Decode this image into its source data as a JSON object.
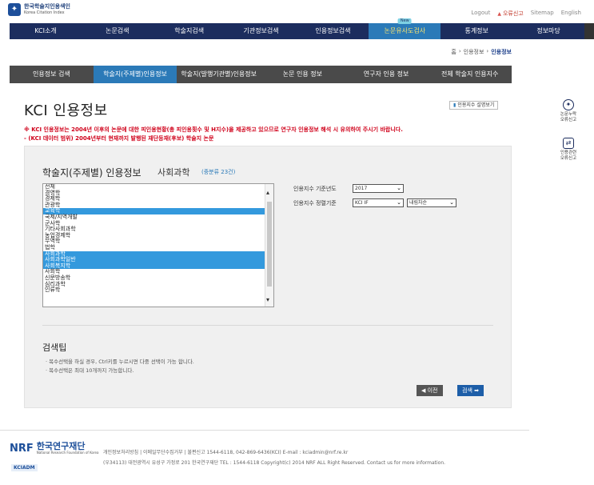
{
  "header": {
    "logo_ko": "한국학술지인용색인",
    "logo_en": "Korea Citation Index",
    "util_links": [
      "Logout",
      "오류신고",
      "Sitemap",
      "English"
    ]
  },
  "main_nav": {
    "items": [
      {
        "label": "KCI소개"
      },
      {
        "label": "논문검색"
      },
      {
        "label": "학술지검색"
      },
      {
        "label": "기관정보검색"
      },
      {
        "label": "인용정보검색"
      },
      {
        "label": "논문유사도검사",
        "badge": "New"
      },
      {
        "label": "통계정보"
      },
      {
        "label": "정보마당"
      }
    ]
  },
  "breadcrumb": {
    "home": "홈",
    "sep": "›",
    "parent": "인용정보",
    "current": "인용정보"
  },
  "sub_nav": {
    "items": [
      "인용정보 검색",
      "학술지(주제별)인용정보",
      "학술지(발행기관별)인용정보",
      "논문 인용 정보",
      "연구자 인용 정보",
      "전체 학술지 인용지수"
    ],
    "active_index": 1
  },
  "page": {
    "title": "KCI 인용정보",
    "guide_button": "인용지수 설명보기",
    "notice1": "※ KCI 인용정보는 2004년 이후의 논문에 대한 피인용현황(총 피인용횟수 및 H지수)을 제공하고 있으므로 연구자 인용정보 해석 시 유의하여 주시기 바랍니다.",
    "notice2": "- (KCI 데이터 범위) 2004년부터 현재까지 발행된 재단등재(후보) 학술지 논문"
  },
  "panel": {
    "title": "학술지(주제별) 인용정보",
    "subject": "사회과학",
    "count": "(중분류 23건)",
    "list_options": [
      {
        "label": "전체",
        "selected": false
      },
      {
        "label": "경영학",
        "selected": false
      },
      {
        "label": "경제학",
        "selected": false
      },
      {
        "label": "관광학",
        "selected": false
      },
      {
        "label": "교육학",
        "selected": true
      },
      {
        "label": "국제/지역개발",
        "selected": false
      },
      {
        "label": "군사학",
        "selected": false
      },
      {
        "label": "기타사회과학",
        "selected": false
      },
      {
        "label": "농업경제학",
        "selected": false
      },
      {
        "label": "무역학",
        "selected": false
      },
      {
        "label": "법학",
        "selected": false
      },
      {
        "label": "사회과학",
        "selected": true
      },
      {
        "label": "사회과학일반",
        "selected": true
      },
      {
        "label": "사회복지학",
        "selected": true
      },
      {
        "label": "사회학",
        "selected": false
      },
      {
        "label": "신문방송학",
        "selected": false
      },
      {
        "label": "심리과학",
        "selected": false
      },
      {
        "label": "인류학",
        "selected": false
      }
    ],
    "year_label": "인용지수 기준년도",
    "year_value": "2017",
    "sort_label": "인용지수 정렬기준",
    "sort_value": "KCI IF",
    "order_value": "내림차순",
    "tips_title": "검색팁",
    "tips": [
      "· 복수선택을 하실 경우, Ctrl키를 누르시면 다중 선택이 가능 합니다.",
      "· 복수선택은 최대 10개까지 가능합니다."
    ],
    "prev_button": "◀ 이전",
    "search_button": "검색 ➡"
  },
  "side": {
    "item1": [
      "논문누락",
      "오류신고"
    ],
    "item2": [
      "인용관련",
      "오류신고"
    ]
  },
  "footer": {
    "logo_mark": "NRF",
    "logo_ko": "한국연구재단",
    "logo_en": "National Research Foundation of Korea",
    "kciadm": "KCIADM",
    "line1": "개인정보처리방침  |  이메일무단수집거부  |  불편신고 1544-6118, 042-869-6436(KCI)  E-mail : kciadmin@nrf.re.kr",
    "line2": "(우34113) 대전광역시 유성구 가정로 201 한국연구재단   TEL : 1544-6118   Copyright(c) 2014 NRF ALL Right Reserved. Contact us for more information."
  }
}
